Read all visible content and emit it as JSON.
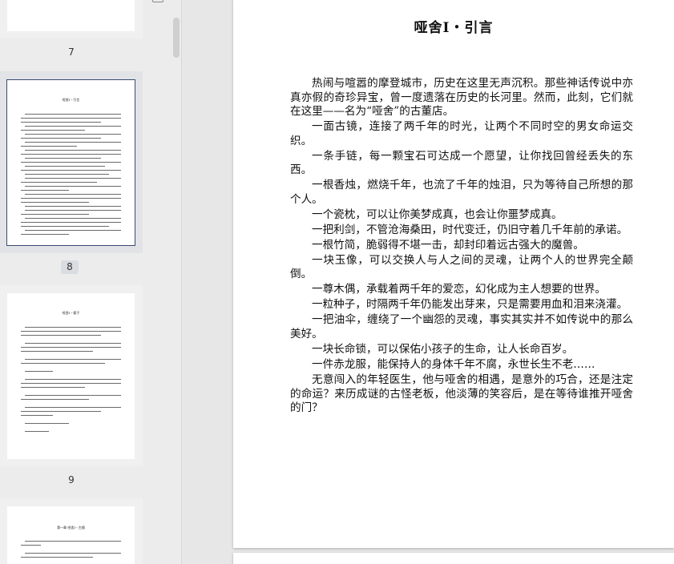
{
  "sidebar": {
    "thumbnails": [
      {
        "page_label": "7"
      },
      {
        "page_label": "8",
        "selected": true,
        "title": "哑舍Ⅰ・引言"
      },
      {
        "page_label": "9",
        "title": "哑舍Ⅰ・楔子"
      },
      {
        "page_label": "",
        "title": "第一章 哑舍Ⅰ・古镜"
      }
    ]
  },
  "document": {
    "title": "哑舍Ⅰ・引言",
    "paragraphs": [
      "热闹与喧嚣的摩登城市，历史在这里无声沉积。那些神话传说中亦真亦假的奇珍异宝，曾一度遗落在历史的长河里。然而，此刻，它们就在这里——名为“哑舍”的古董店。",
      "一面古镜，连接了两千年的时光，让两个不同时空的男女命运交织。",
      "一条手链，每一颗宝石可达成一个愿望，让你找回曾经丢失的东西。",
      "一根香烛，燃烧千年，也流了千年的烛泪，只为等待自己所想的那个人。",
      "一个瓷枕，可以让你美梦成真，也会让你噩梦成真。",
      "一把利剑，不管沧海桑田，时代变迁，仍旧守着几千年前的承诺。",
      "一根竹简，脆弱得不堪一击，却封印着远古强大的魔兽。",
      "一块玉像，可以交换人与人之间的灵魂，让两个人的世界完全颠倒。",
      "一尊木偶，承载着两千年的爱恋，幻化成为主人想要的世界。",
      "一粒种子，时隔两千年仍能发出芽来，只是需要用血和泪来浇灌。",
      "一把油伞，缠绕了一个幽怨的灵魂，事实其实并不如传说中的那么美好。",
      "一块长命锁，可以保佑小孩子的生命，让人长命百岁。",
      "一件赤龙服，能保持人的身体千年不腐，永世长生不老……",
      "无意闯入的年轻医生，他与哑舍的相遇，是意外的巧合，还是注定的命运？来历成谜的古怪老板，他淡薄的笑容后，是在等待谁推开哑舍的门？"
    ]
  }
}
